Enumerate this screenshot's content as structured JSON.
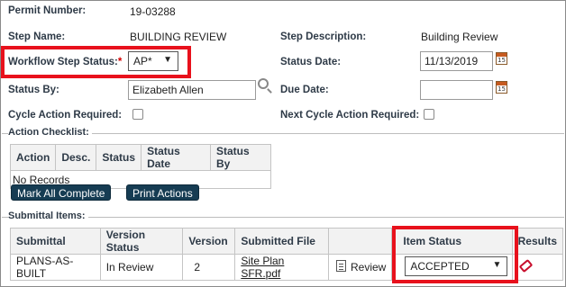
{
  "fields": {
    "permit_number_label": "Permit Number:",
    "permit_number_value": "19-03288",
    "step_name_label": "Step Name:",
    "step_name_value": "BUILDING REVIEW",
    "step_description_label": "Step Description:",
    "step_description_value": "Building Review",
    "workflow_step_status_label": "Workflow Step Status:",
    "required_marker": "*",
    "workflow_step_status_value": "AP*",
    "status_date_label": "Status Date:",
    "status_date_value": "11/13/2019",
    "status_by_label": "Status By:",
    "status_by_value": "Elizabeth Allen",
    "due_date_label": "Due Date:",
    "due_date_value": "",
    "cycle_action_required_label": "Cycle Action Required:",
    "next_cycle_action_required_label": "Next Cycle Action Required:"
  },
  "calendar_glyph": "15",
  "dropdown_caret": "▼",
  "action_checklist": {
    "title": "Action Checklist:",
    "columns": [
      "Action",
      "Desc.",
      "Status",
      "Status Date",
      "Status By"
    ],
    "empty_text": "No Records",
    "buttons": {
      "mark_all_complete": "Mark All Complete",
      "print_actions": "Print Actions"
    }
  },
  "submittal_items": {
    "title": "Submittal Items:",
    "columns": [
      "Submittal",
      "Version Status",
      "Version",
      "Submitted File",
      "",
      "Item Status",
      "Results"
    ],
    "rows": [
      {
        "submittal": "PLANS-AS-BUILT",
        "version_status": "In Review",
        "version": "2",
        "submitted_file": "Site Plan SFR.pdf",
        "review_label": "Review",
        "item_status": "ACCEPTED"
      }
    ]
  },
  "colors": {
    "highlight": "#e8111c",
    "button_bg": "#163c53",
    "label_text": "#2e3a47"
  },
  "icons": [
    "calendar-icon",
    "search-icon",
    "document-icon",
    "tag-icon",
    "chevron-down-icon"
  ]
}
